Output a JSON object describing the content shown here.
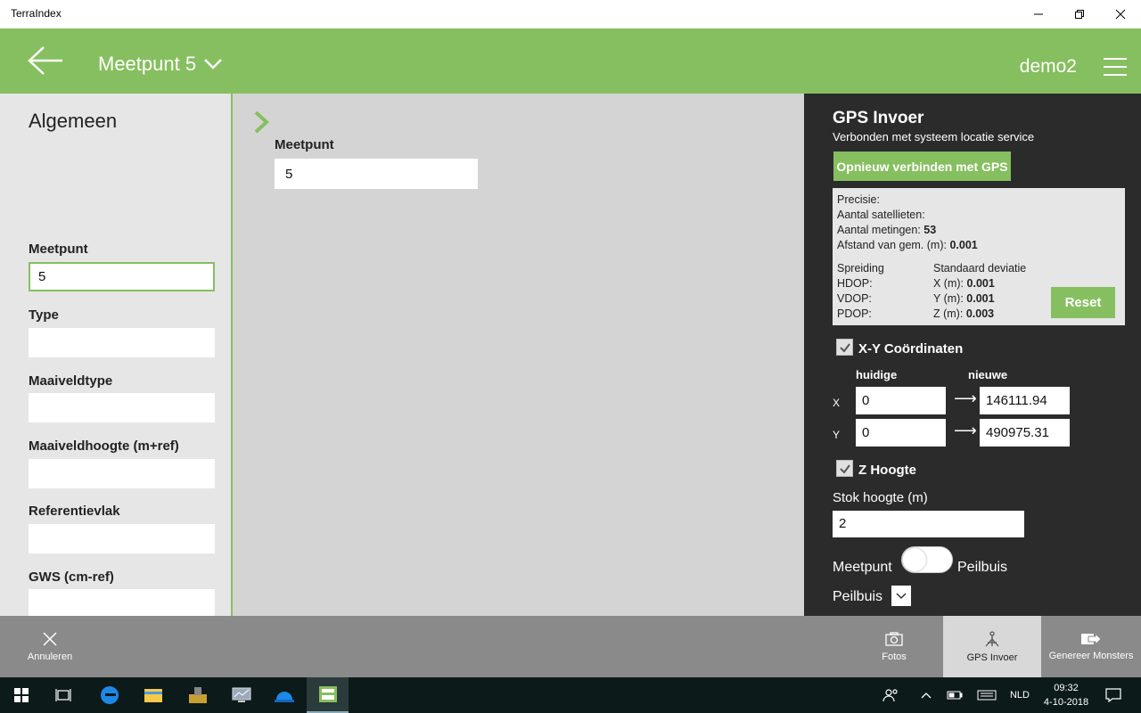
{
  "window": {
    "title": "TerraIndex"
  },
  "header": {
    "title": "Meetpunt 5",
    "user": "demo2"
  },
  "left": {
    "section_title": "Algemeen",
    "fields": [
      {
        "label": "Meetpunt",
        "value": "5"
      },
      {
        "label": "Type",
        "value": ""
      },
      {
        "label": "Maaiveldtype",
        "value": ""
      },
      {
        "label": "Maaiveldhoogte (m+ref)",
        "value": ""
      },
      {
        "label": "Referentievlak",
        "value": ""
      },
      {
        "label": "GWS (cm-ref)",
        "value": ""
      }
    ]
  },
  "middle": {
    "label": "Meetpunt",
    "value": "5"
  },
  "gps": {
    "title": "GPS Invoer",
    "status": "Verbonden met systeem locatie service",
    "reconnect_label": "Opnieuw verbinden met GPS",
    "precisie_label": "Precisie:",
    "satellieten_label": "Aantal satellieten:",
    "metingen_label": "Aantal metingen:",
    "metingen_value": "53",
    "afstand_label": "Afstand van gem. (m):",
    "afstand_value": "0.001",
    "spreiding_label": "Spreiding",
    "stddev_label": "Standaard deviatie",
    "hdop_label": "HDOP:",
    "vdop_label": "VDOP:",
    "pdop_label": "PDOP:",
    "x_label": "X (m):",
    "x_value": "0.001",
    "y_label": "Y (m):",
    "y_value": "0.001",
    "z_label": "Z (m):",
    "z_value": "0.003",
    "reset_label": "Reset",
    "xy_label": "X-Y Coördinaten",
    "xy_checked": true,
    "col_current": "huidige",
    "col_new": "nieuwe",
    "x_axis": "X",
    "y_axis": "Y",
    "x_current": "0",
    "x_new": "146111.94",
    "y_current": "0",
    "y_new": "490975.31",
    "z_label_check": "Z Hoogte",
    "z_checked": true,
    "stok_label": "Stok hoogte (m)",
    "stok_value": "2",
    "toggle_left": "Meetpunt",
    "toggle_right": "Peilbuis",
    "peilbuis_label": "Peilbuis"
  },
  "appbar": {
    "cancel_label": "Annuleren",
    "photos_label": "Fotos",
    "gps_label": "GPS Invoer",
    "generate_label": "Genereer Monsters"
  },
  "taskbar": {
    "lang": "NLD",
    "time": "09:32",
    "date": "4-10-2018"
  },
  "colors": {
    "accent": "#86bf5f",
    "panel_dark": "#2b2b2b",
    "appbar": "#8a8a8a"
  }
}
